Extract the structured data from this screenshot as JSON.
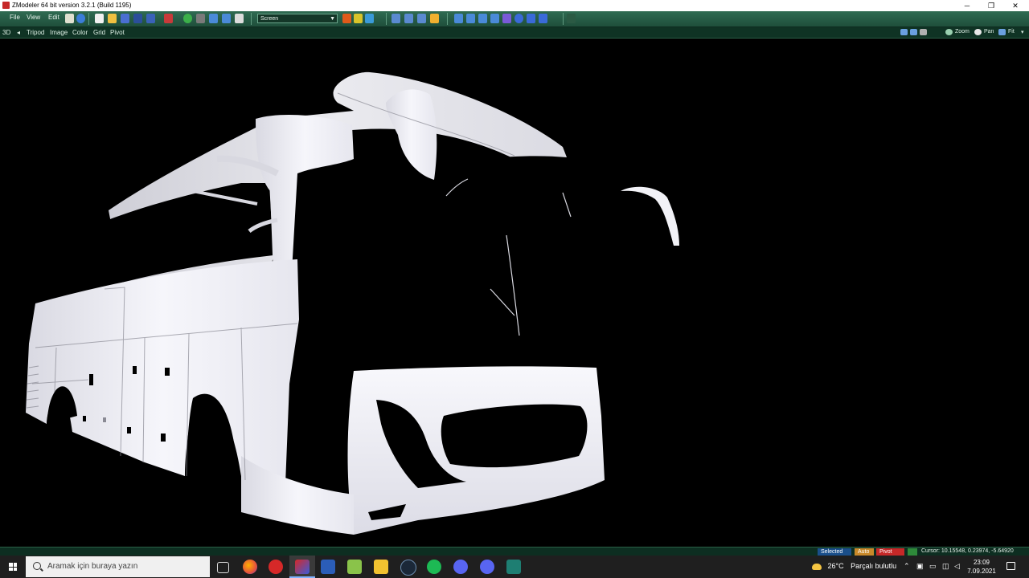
{
  "window": {
    "title": "ZModeler 64 bit version 3.2.1 (Build 1195)",
    "minimize": "─",
    "maximize": "❐",
    "close": "✕"
  },
  "menu": {
    "items": [
      "File",
      "View",
      "Edit"
    ]
  },
  "toolbar": {
    "screen_select": "Screen"
  },
  "viewbar": {
    "left_items": [
      "3D",
      "◂",
      "Tripod",
      "Image",
      "Color",
      "Grid",
      "Pivot"
    ],
    "right_tools": [
      "Zoom",
      "Pan",
      "Fit"
    ]
  },
  "viewport": {
    "background": "#000000",
    "model_color": "#f2f2f7"
  },
  "status": {
    "selected": "Selected",
    "auto": "Auto",
    "pivot": "Pivot",
    "cursor": "Cursor: 10.15548, 0.23974, -5.64920",
    "colors": {
      "selected": "#1a4f8a",
      "auto": "#c8892a",
      "pivot": "#c62828"
    }
  },
  "taskbar": {
    "search_placeholder": "Aramak için buraya yazın",
    "apps": [
      "task-view-icon",
      "firefox-icon",
      "media-player-icon",
      "zmodeler-icon",
      "editor-icon",
      "notepad-icon",
      "file-explorer-icon",
      "steam-icon",
      "spotify-icon",
      "discord-icon",
      "discord-alt-icon",
      "app-icon"
    ],
    "weather_temp": "26°C",
    "weather_text": "Parçalı bulutlu",
    "time": "23:09",
    "date": "7.09.2021"
  }
}
